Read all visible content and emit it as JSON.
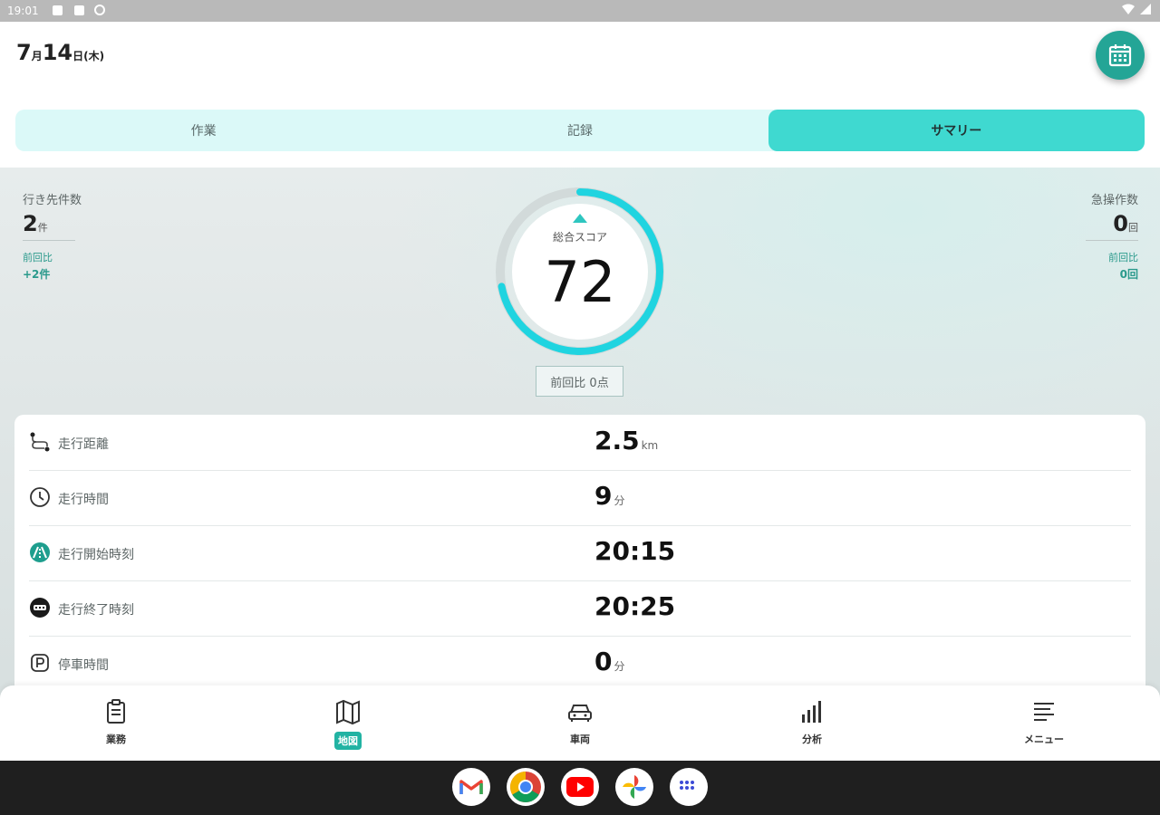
{
  "status_bar": {
    "time": "19:01"
  },
  "header": {
    "month": "7",
    "month_suffix": "月",
    "day": "14",
    "day_suffix": "日(木)"
  },
  "tabs": [
    {
      "label": "作業",
      "active": false
    },
    {
      "label": "記録",
      "active": false
    },
    {
      "label": "サマリー",
      "active": true
    }
  ],
  "left_stat": {
    "label": "行き先件数",
    "value": "2",
    "unit": "件",
    "compare_label": "前回比",
    "compare_value": "+2件"
  },
  "right_stat": {
    "label": "急操作数",
    "value": "0",
    "unit": "回",
    "compare_label": "前回比",
    "compare_value": "0回"
  },
  "score": {
    "label": "総合スコア",
    "value": "72",
    "progress": 0.72,
    "compare": "前回比 0点"
  },
  "metrics": [
    {
      "icon": "route-icon",
      "label": "走行距離",
      "value": "2.5",
      "unit": "km"
    },
    {
      "icon": "clock-icon",
      "label": "走行時間",
      "value": "9",
      "unit": "分"
    },
    {
      "icon": "start-icon",
      "label": "走行開始時刻",
      "value": "20:15",
      "unit": ""
    },
    {
      "icon": "end-icon",
      "label": "走行終了時刻",
      "value": "20:25",
      "unit": ""
    },
    {
      "icon": "parking-icon",
      "label": "停車時間",
      "value": "0",
      "unit": "分"
    }
  ],
  "bottom_nav": [
    {
      "icon": "clipboard-icon",
      "label": "業務",
      "active": false
    },
    {
      "icon": "map-icon",
      "label": "地図",
      "active": true
    },
    {
      "icon": "car-icon",
      "label": "車両",
      "active": false
    },
    {
      "icon": "bar-chart-icon",
      "label": "分析",
      "active": false
    },
    {
      "icon": "menu-icon",
      "label": "メニュー",
      "active": false
    }
  ],
  "dock": [
    {
      "icon": "gmail-icon"
    },
    {
      "icon": "chrome-icon"
    },
    {
      "icon": "youtube-icon"
    },
    {
      "icon": "photos-icon"
    },
    {
      "icon": "apps-icon"
    }
  ],
  "colors": {
    "accent": "#3fd9d0",
    "accent_dark": "#24a596",
    "ring": "#1fd4e0"
  }
}
